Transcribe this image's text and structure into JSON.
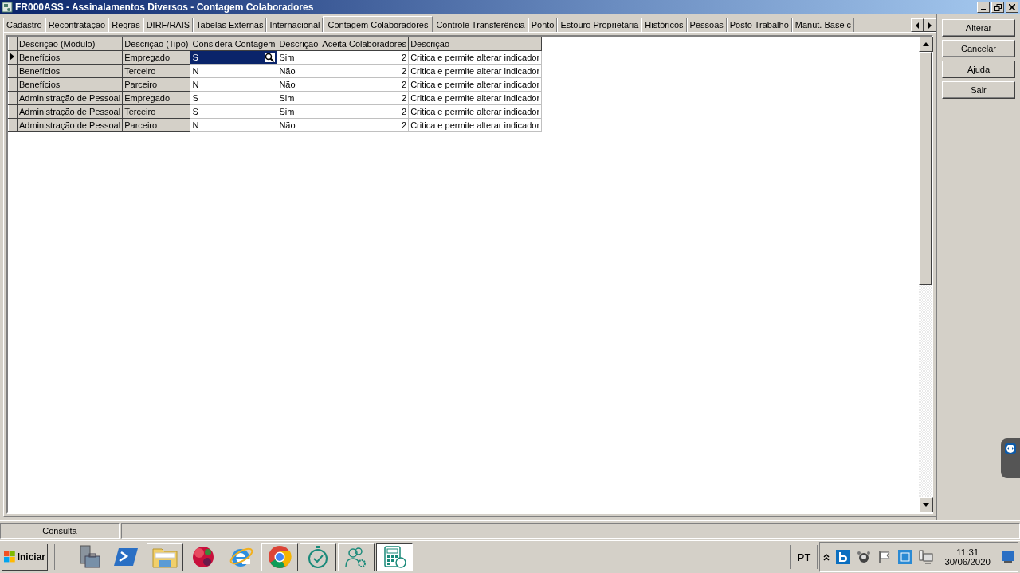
{
  "window": {
    "title": "FR000ASS - Assinalamentos Diversos - Contagem Colaboradores"
  },
  "tabs": [
    {
      "label": "Cadastro",
      "selected": false
    },
    {
      "label": "Recontratação",
      "selected": false
    },
    {
      "label": "Regras",
      "selected": false
    },
    {
      "label": "DIRF/RAIS",
      "selected": false
    },
    {
      "label": "Tabelas Externas",
      "selected": false
    },
    {
      "label": "Internacional",
      "selected": false
    },
    {
      "label": "Contagem Colaboradores",
      "selected": true
    },
    {
      "label": "Controle Transferência",
      "selected": false
    },
    {
      "label": "Ponto",
      "selected": false
    },
    {
      "label": "Estouro Proprietária",
      "selected": false
    },
    {
      "label": "Históricos",
      "selected": false
    },
    {
      "label": "Pessoas",
      "selected": false
    },
    {
      "label": "Posto Trabalho",
      "selected": false
    },
    {
      "label": "Manut. Base c",
      "selected": false
    }
  ],
  "grid": {
    "columns": [
      {
        "label": "Descrição (Módulo)",
        "kind": "fixed"
      },
      {
        "label": "Descrição (Tipo)",
        "kind": "fixed"
      },
      {
        "label": "Considera Contagem",
        "kind": "lookup"
      },
      {
        "label": "Descrição",
        "kind": "text"
      },
      {
        "label": "Aceita Colaboradores",
        "kind": "number"
      },
      {
        "label": "Descrição",
        "kind": "text"
      }
    ],
    "rows": [
      {
        "selected": true,
        "cells": [
          {
            "text": "Benefícios",
            "focused": false
          },
          {
            "text": "Empregado",
            "focused": false
          },
          {
            "text": "S",
            "focused": true
          },
          {
            "text": "Sim",
            "focused": false
          },
          {
            "text": "2",
            "focused": false
          },
          {
            "text": "Critica e permite alterar indicador",
            "focused": false
          }
        ]
      },
      {
        "selected": false,
        "cells": [
          {
            "text": "Benefícios",
            "focused": false
          },
          {
            "text": "Terceiro",
            "focused": false
          },
          {
            "text": "N",
            "focused": false
          },
          {
            "text": "Não",
            "focused": false
          },
          {
            "text": "2",
            "focused": false
          },
          {
            "text": "Critica e permite alterar indicador",
            "focused": false
          }
        ]
      },
      {
        "selected": false,
        "cells": [
          {
            "text": "Benefícios",
            "focused": false
          },
          {
            "text": "Parceiro",
            "focused": false
          },
          {
            "text": "N",
            "focused": false
          },
          {
            "text": "Não",
            "focused": false
          },
          {
            "text": "2",
            "focused": false
          },
          {
            "text": "Critica e permite alterar indicador",
            "focused": false
          }
        ]
      },
      {
        "selected": false,
        "cells": [
          {
            "text": "Administração de Pessoal",
            "focused": false
          },
          {
            "text": "Empregado",
            "focused": false
          },
          {
            "text": "S",
            "focused": false
          },
          {
            "text": "Sim",
            "focused": false
          },
          {
            "text": "2",
            "focused": false
          },
          {
            "text": "Critica e permite alterar indicador",
            "focused": false
          }
        ]
      },
      {
        "selected": false,
        "cells": [
          {
            "text": "Administração de Pessoal",
            "focused": false
          },
          {
            "text": "Terceiro",
            "focused": false
          },
          {
            "text": "S",
            "focused": false
          },
          {
            "text": "Sim",
            "focused": false
          },
          {
            "text": "2",
            "focused": false
          },
          {
            "text": "Critica e permite alterar indicador",
            "focused": false
          }
        ]
      },
      {
        "selected": false,
        "cells": [
          {
            "text": "Administração de Pessoal",
            "focused": false
          },
          {
            "text": "Parceiro",
            "focused": false
          },
          {
            "text": "N",
            "focused": false
          },
          {
            "text": "Não",
            "focused": false
          },
          {
            "text": "2",
            "focused": false
          },
          {
            "text": "Critica e permite alterar indicador",
            "focused": false
          }
        ]
      }
    ]
  },
  "buttons": [
    {
      "label": "Alterar"
    },
    {
      "label": "Cancelar"
    },
    {
      "label": "Ajuda"
    },
    {
      "label": "Sair"
    }
  ],
  "status_bar": {
    "panels": [
      "Consulta"
    ]
  },
  "taskbar": {
    "start": "Iniciar",
    "items": [
      {
        "kind": "server-tools",
        "open": false,
        "active": false
      },
      {
        "kind": "powershell",
        "open": false,
        "active": false
      },
      {
        "kind": "folder",
        "open": true,
        "active": false
      },
      {
        "kind": "ball",
        "open": false,
        "active": false
      },
      {
        "kind": "ie",
        "open": false,
        "active": false
      },
      {
        "kind": "chrome",
        "open": true,
        "active": false
      },
      {
        "kind": "stopwatch",
        "open": true,
        "active": false
      },
      {
        "kind": "users",
        "open": true,
        "active": false
      },
      {
        "kind": "calculator",
        "open": true,
        "active": true
      }
    ],
    "language": "PT",
    "time": "11:31",
    "date": "30/06/2020"
  }
}
